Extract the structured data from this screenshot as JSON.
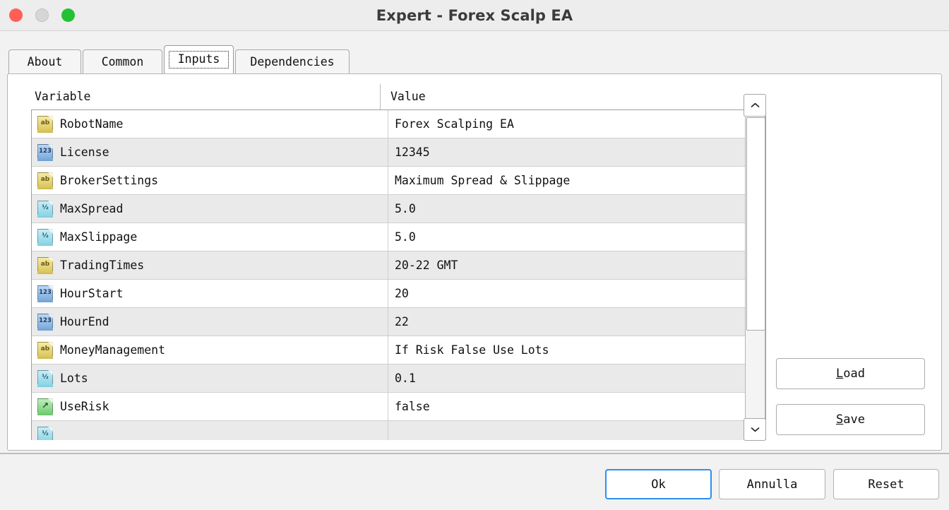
{
  "window": {
    "title": "Expert - Forex Scalp EA",
    "traffic_lights": [
      {
        "name": "close",
        "color": "#FF5F56"
      },
      {
        "name": "minimize",
        "color": "#D6D6D6"
      },
      {
        "name": "zoom",
        "color": "#23C234"
      }
    ]
  },
  "tabs": [
    {
      "label": "About",
      "active": false
    },
    {
      "label": "Common",
      "active": false
    },
    {
      "label": "Inputs",
      "active": true
    },
    {
      "label": "Dependencies",
      "active": false
    }
  ],
  "table": {
    "headers": {
      "variable": "Variable",
      "value": "Value"
    },
    "rows": [
      {
        "icon": "string-type-icon",
        "glyph": "ab",
        "type": "str",
        "variable": "RobotName",
        "value": "Forex Scalping EA"
      },
      {
        "icon": "integer-type-icon",
        "glyph": "123",
        "type": "int",
        "variable": "License",
        "value": "12345"
      },
      {
        "icon": "string-type-icon",
        "glyph": "ab",
        "type": "str",
        "variable": "BrokerSettings",
        "value": "Maximum Spread & Slippage"
      },
      {
        "icon": "double-type-icon",
        "glyph": "½",
        "type": "dbl",
        "variable": "MaxSpread",
        "value": "5.0"
      },
      {
        "icon": "double-type-icon",
        "glyph": "½",
        "type": "dbl",
        "variable": "MaxSlippage",
        "value": "5.0"
      },
      {
        "icon": "string-type-icon",
        "glyph": "ab",
        "type": "str",
        "variable": "TradingTimes",
        "value": "20-22 GMT"
      },
      {
        "icon": "integer-type-icon",
        "glyph": "123",
        "type": "int",
        "variable": "HourStart",
        "value": "20"
      },
      {
        "icon": "integer-type-icon",
        "glyph": "123",
        "type": "int",
        "variable": "HourEnd",
        "value": "22"
      },
      {
        "icon": "string-type-icon",
        "glyph": "ab",
        "type": "str",
        "variable": "MoneyManagement",
        "value": "If Risk False Use Lots"
      },
      {
        "icon": "double-type-icon",
        "glyph": "½",
        "type": "dbl",
        "variable": "Lots",
        "value": "0.1"
      },
      {
        "icon": "bool-type-icon",
        "glyph": "↗",
        "type": "bool",
        "variable": "UseRisk",
        "value": "false"
      },
      {
        "icon": "double-type-icon",
        "glyph": "½",
        "type": "dbl",
        "variable": "",
        "value": ""
      }
    ]
  },
  "scrollbar": {
    "up_arrow": "chevron-up-icon",
    "down_arrow": "chevron-down-icon"
  },
  "side_buttons": {
    "load": {
      "accel": "L",
      "rest": "oad"
    },
    "save": {
      "accel": "S",
      "rest": "ave"
    }
  },
  "footer_buttons": {
    "ok": "Ok",
    "cancel": "Annulla",
    "reset": "Reset"
  },
  "colors": {
    "accent": "#2A8FF7",
    "titlebar": "#EDEDED",
    "row_alt": "#EAEAEA",
    "panel_bg": "#FFFFFF"
  }
}
